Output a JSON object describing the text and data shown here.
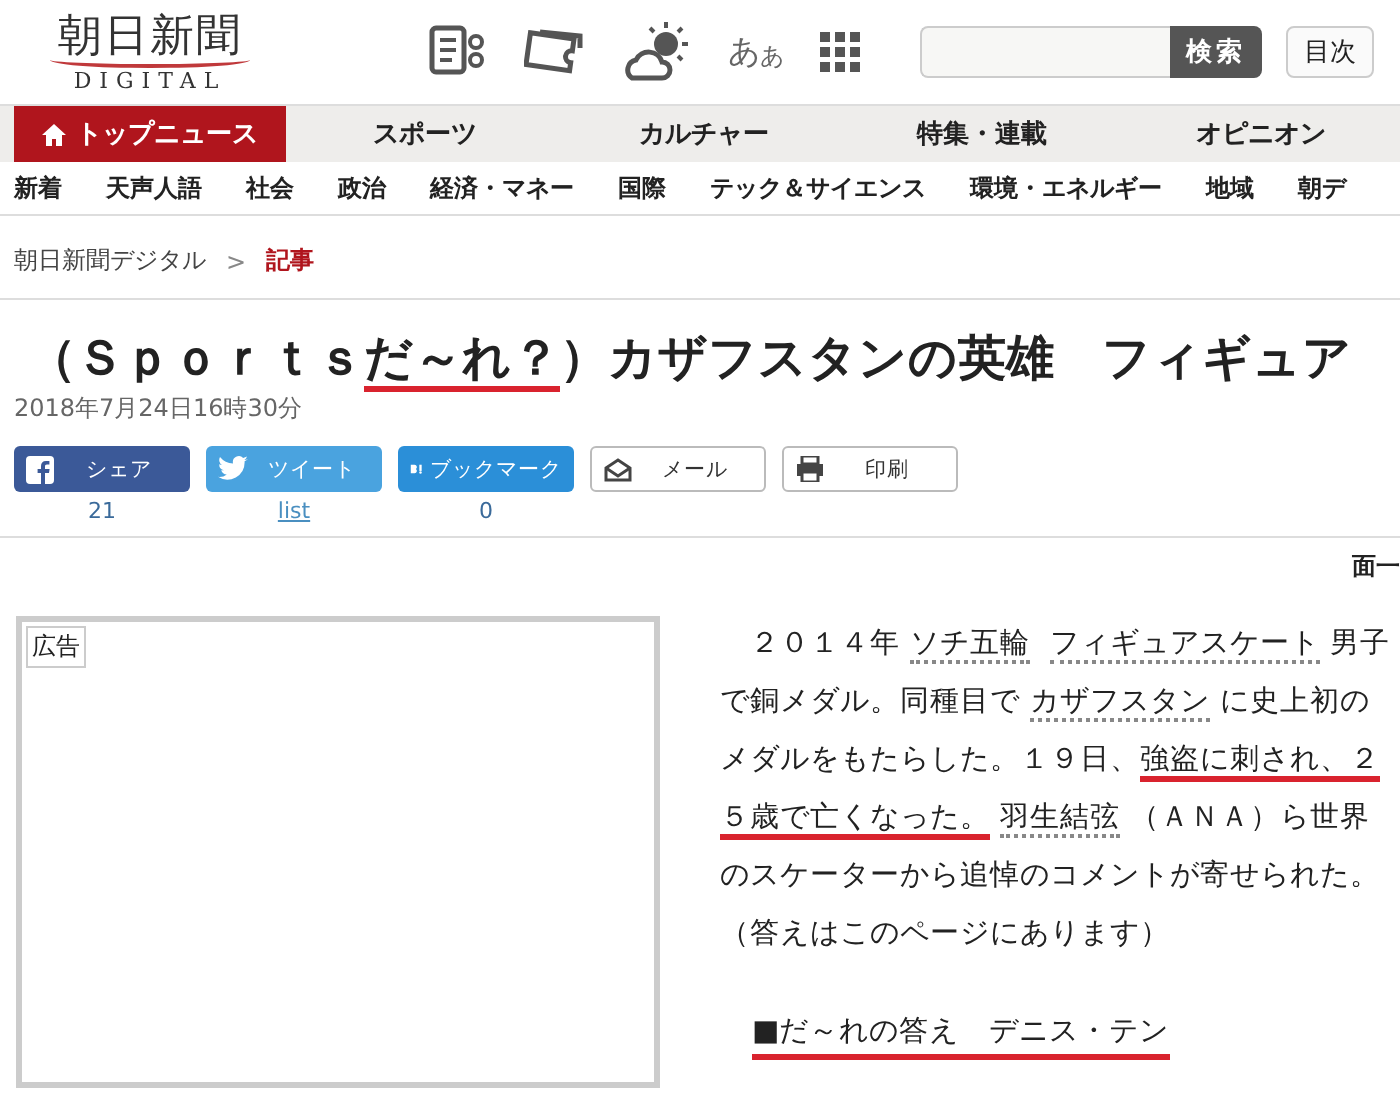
{
  "logo": {
    "name": "朝日新聞",
    "sub": "DIGITAL"
  },
  "toolbar": {
    "font_size": [
      "あ",
      "あ"
    ]
  },
  "search": {
    "button": "検索"
  },
  "index_button": "目次",
  "main_nav": [
    {
      "label": "トップニュース",
      "selected": true
    },
    {
      "label": "スポーツ",
      "selected": false
    },
    {
      "label": "カルチャー",
      "selected": false
    },
    {
      "label": "特集・連載",
      "selected": false
    },
    {
      "label": "オピニオン",
      "selected": false
    }
  ],
  "sub_nav": [
    "新着",
    "天声人語",
    "社会",
    "政治",
    "経済・マネー",
    "国際",
    "テック＆サイエンス",
    "環境・エネルギー",
    "地域",
    "朝デ"
  ],
  "breadcrumb": {
    "items": [
      {
        "label": "朝日新聞デジタル",
        "current": false
      },
      {
        "label": "記事",
        "current": true
      }
    ],
    "separator": ">"
  },
  "article": {
    "title": [
      {
        "text": "（Ｓｐｏｒｔｓ",
        "marked": false
      },
      {
        "text": "だ～れ？",
        "marked": true
      },
      {
        "text": "）カザフスタンの英雄　フィギュア",
        "marked": false
      }
    ],
    "date": "2018年7月24日16時30分",
    "share": [
      {
        "kind": "facebook",
        "label": "シェア",
        "count": "21"
      },
      {
        "kind": "twitter",
        "label": "ツイート",
        "count": "list"
      },
      {
        "kind": "hatena",
        "label": "ブックマーク",
        "count": "0"
      },
      {
        "kind": "mail",
        "label": "メール"
      },
      {
        "kind": "print",
        "label": "印刷"
      }
    ],
    "page_link": "面一",
    "ad": {
      "label": "広告"
    },
    "body": [
      {
        "text": "　２０１４年",
        "kind": "plain"
      },
      {
        "text": "ソチ五輪",
        "kind": "link"
      },
      {
        "text": "フィギュアスケート",
        "kind": "link"
      },
      {
        "text": "男子で銅メダル。同種目で",
        "kind": "plain"
      },
      {
        "text": "カザフスタン",
        "kind": "link"
      },
      {
        "text": "に史上初のメダルをもたらした。１９日、",
        "kind": "plain"
      },
      {
        "text": "強盗に刺され、２５歳で亡くなった。",
        "kind": "marked"
      },
      {
        "text": "羽生結弦",
        "kind": "link"
      },
      {
        "text": "（ＡＮＡ）ら世界のスケーターから追悼のコメントが寄せられた。",
        "kind": "plain"
      }
    ],
    "note": "（答えはこのページにあります）",
    "answer": {
      "text": "■だ～れの答え　デニス・テン",
      "marked": true
    }
  }
}
